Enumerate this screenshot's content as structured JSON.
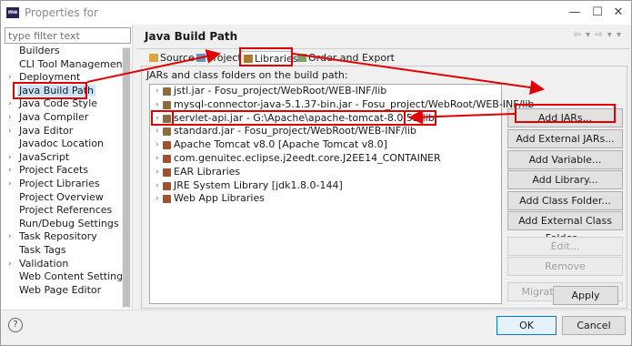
{
  "window": {
    "title": "Properties for",
    "app_icon_text": "eclipse"
  },
  "filter": {
    "placeholder": "type filter text"
  },
  "nav_tree": [
    {
      "label": "Builders",
      "expandable": false,
      "selected": false
    },
    {
      "label": "CLI Tool Management",
      "expandable": false,
      "selected": false
    },
    {
      "label": "Deployment",
      "expandable": true,
      "selected": false
    },
    {
      "label": "Java Build Path",
      "expandable": false,
      "selected": true
    },
    {
      "label": "Java Code Style",
      "expandable": true,
      "selected": false
    },
    {
      "label": "Java Compiler",
      "expandable": true,
      "selected": false
    },
    {
      "label": "Java Editor",
      "expandable": true,
      "selected": false
    },
    {
      "label": "Javadoc Location",
      "expandable": false,
      "selected": false
    },
    {
      "label": "JavaScript",
      "expandable": true,
      "selected": false
    },
    {
      "label": "Project Facets",
      "expandable": true,
      "selected": false
    },
    {
      "label": "Project Libraries",
      "expandable": true,
      "selected": false
    },
    {
      "label": "Project Overview",
      "expandable": false,
      "selected": false
    },
    {
      "label": "Project References",
      "expandable": false,
      "selected": false
    },
    {
      "label": "Run/Debug Settings",
      "expandable": false,
      "selected": false
    },
    {
      "label": "Task Repository",
      "expandable": true,
      "selected": false
    },
    {
      "label": "Task Tags",
      "expandable": false,
      "selected": false
    },
    {
      "label": "Validation",
      "expandable": true,
      "selected": false
    },
    {
      "label": "Web Content Settings",
      "expandable": false,
      "selected": false
    },
    {
      "label": "Web Page Editor",
      "expandable": false,
      "selected": false
    }
  ],
  "page": {
    "title": "Java Build Path",
    "nav_arrows": "⇦ ▾ ⇨ ▾ ▾"
  },
  "tabs": [
    {
      "label": "Source",
      "icon": "source-folder-icon",
      "active": false
    },
    {
      "label": "Projects",
      "icon": "projects-icon",
      "active": false
    },
    {
      "label": "Libraries",
      "icon": "libraries-icon",
      "active": true
    },
    {
      "label": "Order and Export",
      "icon": "order-export-icon",
      "active": false
    }
  ],
  "libraries": {
    "caption": "JARs and class folders on the build path:",
    "items": [
      {
        "label": "jstl.jar - Fosu_project/WebRoot/WEB-INF/lib",
        "icon": "jar-icon",
        "color": "#8a6d3b",
        "highlight": false
      },
      {
        "label": "mysql-connector-java-5.1.37-bin.jar - Fosu_project/WebRoot/WEB-INF/lib",
        "icon": "jar-icon",
        "color": "#8a6d3b",
        "highlight": false
      },
      {
        "label": "servlet-api.jar - G:\\Apache\\apache-tomcat-8.0.53\\lib",
        "icon": "jar-icon",
        "color": "#8a6d3b",
        "highlight": true
      },
      {
        "label": "standard.jar - Fosu_project/WebRoot/WEB-INF/lib",
        "icon": "jar-icon",
        "color": "#8a6d3b",
        "highlight": false
      },
      {
        "label": "Apache Tomcat v8.0 [Apache Tomcat v8.0]",
        "icon": "library-icon",
        "color": "#a0522d",
        "highlight": false
      },
      {
        "label": "com.genuitec.eclipse.j2eedt.core.J2EE14_CONTAINER",
        "icon": "library-icon",
        "color": "#a0522d",
        "highlight": false
      },
      {
        "label": "EAR Libraries",
        "icon": "library-icon",
        "color": "#a0522d",
        "highlight": false
      },
      {
        "label": "JRE System Library [jdk1.8.0-144]",
        "icon": "library-icon",
        "color": "#a0522d",
        "highlight": false
      },
      {
        "label": "Web App Libraries",
        "icon": "library-icon",
        "color": "#a0522d",
        "highlight": false
      }
    ]
  },
  "buttons": {
    "add_jars": "Add JARs...",
    "add_external_jars": "Add External JARs...",
    "add_variable": "Add Variable...",
    "add_library": "Add Library...",
    "add_class_folder": "Add Class Folder...",
    "add_external_class_folder": "Add External Class Folder...",
    "edit": "Edit...",
    "remove": "Remove",
    "migrate_jar": "Migrate JAR File...",
    "apply": "Apply",
    "ok": "OK",
    "cancel": "Cancel"
  },
  "window_controls": {
    "minimize": "—",
    "maximize": "☐",
    "close": "✕"
  },
  "help": {
    "glyph": "?"
  },
  "colors": {
    "annotation": "#e00000",
    "selection": "#cde4f7",
    "ok_border": "#0078d7"
  }
}
